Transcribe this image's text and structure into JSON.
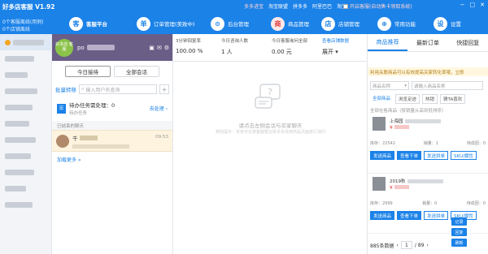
{
  "app": {
    "title": "好多店客服 V1.92",
    "sub1": "0个客服离线(用例)",
    "sub2": "0个店铺离线"
  },
  "nav": [
    {
      "icon": "客",
      "label": "客服平台"
    },
    {
      "icon": "单",
      "label": "订单管理(美致中)"
    },
    {
      "icon": "⊙",
      "label": "后台管理"
    },
    {
      "icon": "商",
      "label": "商品管理"
    },
    {
      "icon": "店",
      "label": "店铺管理"
    },
    {
      "icon": "⊕",
      "label": "常用功能"
    },
    {
      "icon": "设",
      "label": "设置"
    }
  ],
  "top_links": [
    "多多进宝",
    "淘宝联盟",
    "拼多多",
    "阿里巴巴",
    "淘宝"
  ],
  "top_check": "开启客服(自动售卡领取系统)",
  "win_buttons": [
    "−",
    "□",
    "✕"
  ],
  "left_badge": "3",
  "user": {
    "avatar": "好多店 客服",
    "prefix": "po"
  },
  "chat_tabs": [
    "今日接待",
    "全部会话"
  ],
  "search": {
    "label": "批量转移",
    "placeholder": "输入用户名查询"
  },
  "task": {
    "title": "待办任务需处理：0",
    "sub": "待办任务",
    "go": "去处理 ›"
  },
  "ended_header": "已结束的聊天",
  "conversation": {
    "name": "千",
    "time": "09:53"
  },
  "load_more": "加载更多 »",
  "stats": [
    {
      "label": "3分钟回复率",
      "value": "100.00 %"
    },
    {
      "label": "今日咨询人数",
      "value": "1 人"
    },
    {
      "label": "今日客服询问全部",
      "value": "0.00 元"
    },
    {
      "label": "查看店铺数据",
      "value": "展开 ▾"
    }
  ],
  "empty": {
    "title": "请点击左侧会话与买家聊天",
    "sub": "特别提示：买家可长按客服框在拼多多找到商品页面进行询问"
  },
  "right_tabs": [
    "商品推荐",
    "最新订单",
    "快捷回复"
  ],
  "notice": "利用关联商品可以有效提高买家转化率哦，立即",
  "filters": {
    "category": "商品名称",
    "search_placeholder": "请输入商品名称"
  },
  "chips": [
    "全部商品",
    "浏览足迹",
    "热销",
    "猜TA喜欢"
  ],
  "section_label": "全部在售商品（按销量从高到低排序）",
  "products": [
    {
      "title_prefix": "上海园",
      "price_prefix": "¥",
      "stock": "库存：22542",
      "sales": "销量：1",
      "pending": "待成团：0",
      "buttons": [
        "发送商品",
        "查看下单",
        "发送拼单",
        "SKU/属性"
      ]
    },
    {
      "title_prefix": "2019秋",
      "price_prefix": "¥",
      "stock": "库存：2999",
      "sales": "销量：0",
      "pending": "待成团：0",
      "buttons": [
        "发送商品",
        "查看下单",
        "发送拼单",
        "SKU/属性"
      ]
    }
  ],
  "pager": {
    "count": "885条数据",
    "current": "1",
    "total": "/ 89"
  },
  "float_buttons": [
    "记录",
    "回复",
    "刷新"
  ]
}
